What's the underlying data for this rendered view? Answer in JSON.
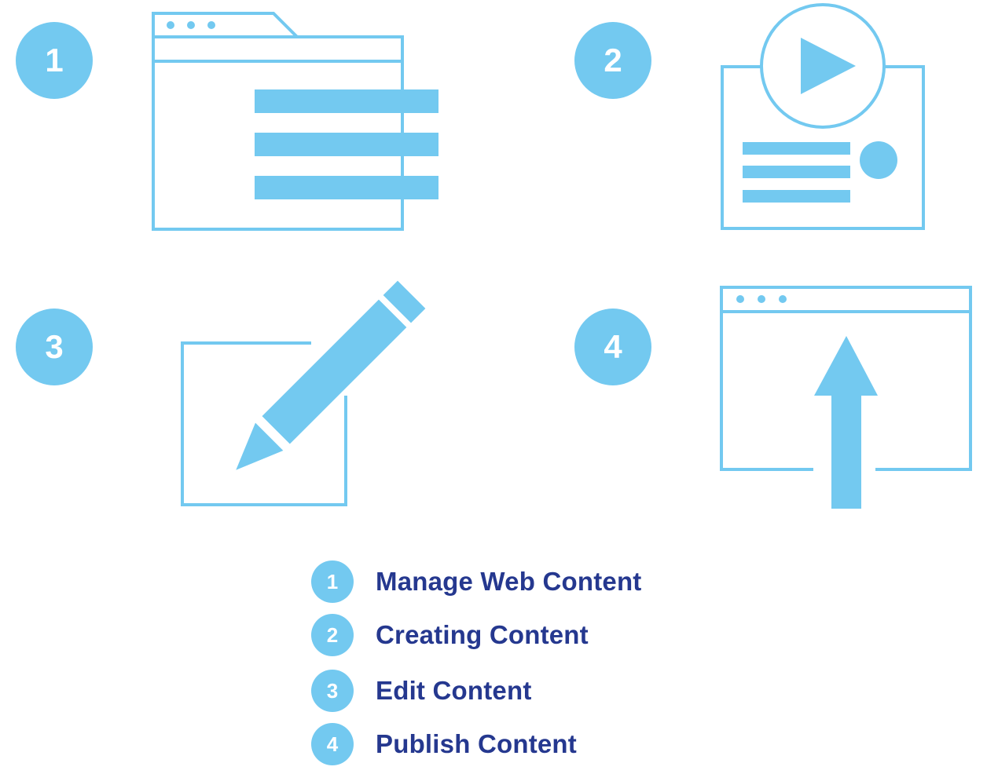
{
  "colors": {
    "accent": "#73C9F0",
    "text": "#25388F",
    "background": "#ffffff"
  },
  "steps": [
    {
      "number": "1",
      "icon": "browser-document-icon"
    },
    {
      "number": "2",
      "icon": "video-content-icon"
    },
    {
      "number": "3",
      "icon": "pencil-edit-icon"
    },
    {
      "number": "4",
      "icon": "browser-upload-icon"
    }
  ],
  "legend": [
    {
      "number": "1",
      "label": "Manage Web Content"
    },
    {
      "number": "2",
      "label": "Creating Content"
    },
    {
      "number": "3",
      "label": "Edit Content"
    },
    {
      "number": "4",
      "label": "Publish Content"
    }
  ]
}
